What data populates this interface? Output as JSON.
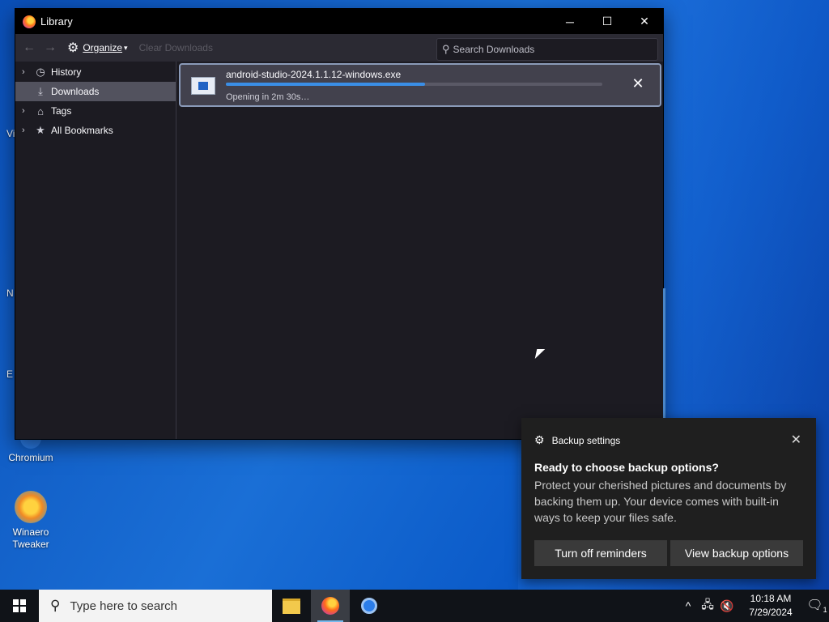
{
  "window": {
    "title": "Library",
    "minimize_glyph": "─",
    "maximize_glyph": "☐",
    "close_glyph": "✕"
  },
  "toolbar": {
    "back_glyph": "←",
    "forward_glyph": "→",
    "organize_label": "Organize",
    "organize_caret": "▾",
    "clear_label": "Clear Downloads",
    "search_placeholder": "Search Downloads"
  },
  "sidebar": {
    "items": [
      {
        "label": "History",
        "icon": "clock-icon",
        "selected": false
      },
      {
        "label": "Downloads",
        "icon": "download-icon",
        "selected": true
      },
      {
        "label": "Tags",
        "icon": "tag-icon",
        "selected": false
      },
      {
        "label": "All Bookmarks",
        "icon": "star-icon",
        "selected": false
      }
    ]
  },
  "download": {
    "filename": "android-studio-2024.1.1.12-windows.exe",
    "status": "Opening in 2m 30s…",
    "progress": 0.53
  },
  "desktop": {
    "icons": [
      {
        "label": "Chromium"
      },
      {
        "label": "Winaero\nTweaker"
      }
    ],
    "peek_labels": [
      "Vi",
      "N",
      "E"
    ]
  },
  "toast": {
    "app": "Backup settings",
    "title": "Ready to choose backup options?",
    "body": "Protect your cherished pictures and documents by backing them up. Your device comes with built-in ways to keep your files safe.",
    "button_1": "Turn off reminders",
    "button_2": "View backup options"
  },
  "taskbar": {
    "search_placeholder": "Type here to search",
    "time": "10:18 AM",
    "date": "7/29/2024",
    "notification_count": "1",
    "accent": "#76b9ed"
  }
}
